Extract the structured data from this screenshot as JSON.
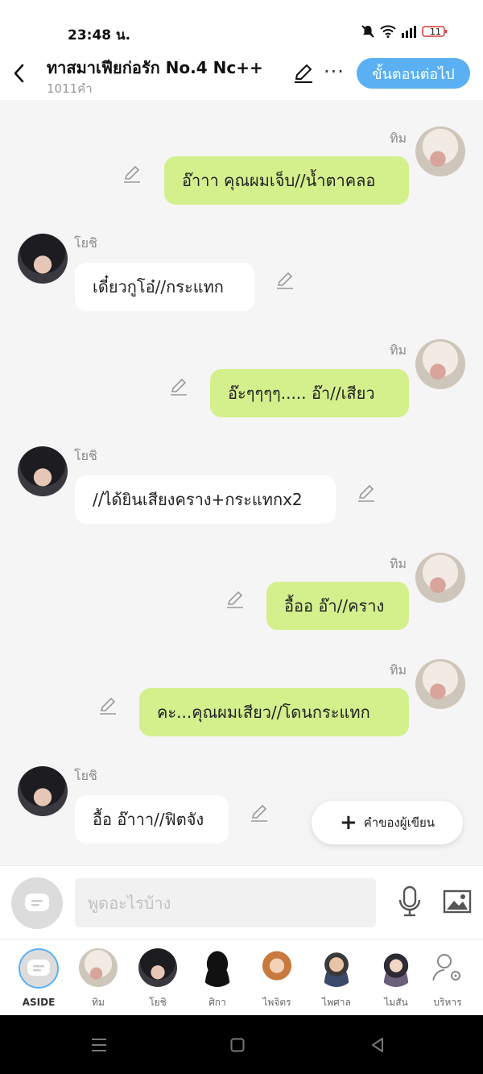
{
  "status": {
    "time": "23:48 น.",
    "battery": "11"
  },
  "header": {
    "title": "ทาสมาเฟียก่อรัก No.4 Nc++",
    "word_count": "1011คำ",
    "next_label": "ขั้นตอนต่อไป"
  },
  "messages": [
    {
      "sender": "ทิม",
      "side": "right",
      "text": "อ๊าาา คุณผมเจ็บ//น้ำตาคลอ"
    },
    {
      "sender": "โยชิ",
      "side": "left",
      "text": "เดี๋ยวกูโอ๋//กระแทก"
    },
    {
      "sender": "ทิม",
      "side": "right",
      "text": "อ๊ะๆๆๆๆ..... อ๊า//เสียว"
    },
    {
      "sender": "โยชิ",
      "side": "left",
      "text": "//ได้ยินเสียงคราง+กระแทกx2"
    },
    {
      "sender": "ทิม",
      "side": "right",
      "text": "อื้ออ อ๊า//คราง"
    },
    {
      "sender": "ทิม",
      "side": "right",
      "text": "คะ...คุณผมเสียว//โดนกระแทก"
    },
    {
      "sender": "โยชิ",
      "side": "left",
      "text": "อื้อ อ๊าาา//ฟิตจัง"
    }
  ],
  "author_note_label": "คำของผู้เขียน",
  "input": {
    "placeholder": "พูดอะไรบ้าง"
  },
  "characters": [
    {
      "label": "ASIDE"
    },
    {
      "label": "ทิม"
    },
    {
      "label": "โยชิ"
    },
    {
      "label": "ศิกา"
    },
    {
      "label": "ไพจิตร"
    },
    {
      "label": "ไพศาล"
    },
    {
      "label": "ไมสัน"
    },
    {
      "label": "บริหาร"
    }
  ],
  "colors": {
    "accent": "#5ab0f3",
    "bubble_right": "#d3f08d",
    "bubble_left": "#ffffff"
  }
}
